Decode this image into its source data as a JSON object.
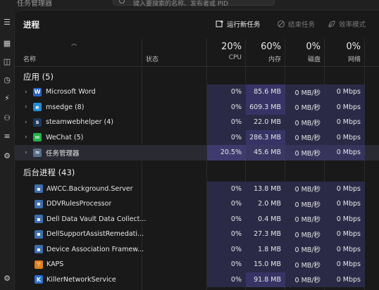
{
  "window": {
    "title": "任务管理器",
    "search_placeholder": "键入要搜索的名称、发布者或 PID"
  },
  "nav": {
    "items": [
      {
        "name": "hamburger-menu-icon",
        "glyph": "☰"
      },
      {
        "name": "processes-icon",
        "glyph": "▦"
      },
      {
        "name": "performance-icon",
        "glyph": "◫"
      },
      {
        "name": "app-history-icon",
        "glyph": "◷"
      },
      {
        "name": "startup-apps-icon",
        "glyph": "⚡"
      },
      {
        "name": "users-icon",
        "glyph": "⚇"
      },
      {
        "name": "details-icon",
        "glyph": "≡"
      },
      {
        "name": "services-icon",
        "glyph": "⚙"
      },
      {
        "name": "settings-icon",
        "glyph": "⚙"
      }
    ]
  },
  "toolbar": {
    "page_title": "进程",
    "run_new_task": "运行新任务",
    "end_task": "结束任务",
    "efficiency_mode": "效率模式"
  },
  "header": {
    "name_label": "名称",
    "status_label": "状态",
    "cpu_pct": "20%",
    "cpu_label": "CPU",
    "mem_pct": "60%",
    "mem_label": "内存",
    "disk_pct": "0%",
    "disk_label": "磁盘",
    "net_pct": "0%",
    "net_label": "网络"
  },
  "sections": {
    "apps_title": "应用 (5)",
    "background_title": "后台进程 (43)"
  },
  "apps": [
    {
      "name": "Microsoft Word",
      "icon": "word-icon",
      "icon_color": "#2b62c4",
      "glyph": "W",
      "cpu": "0%",
      "mem": "85.6 MB",
      "disk": "0 MB/秒",
      "net": "0 Mbps",
      "selected": false
    },
    {
      "name": "msedge (8)",
      "icon": "edge-icon",
      "icon_color": "#1f8fd6",
      "glyph": "e",
      "cpu": "0%",
      "mem": "609.3 MB",
      "disk": "0 MB/秒",
      "net": "0 Mbps",
      "selected": false
    },
    {
      "name": "steamwebhelper (4)",
      "icon": "steam-icon",
      "icon_color": "#1d3b5c",
      "glyph": "s",
      "cpu": "0%",
      "mem": "22.0 MB",
      "disk": "0 MB/秒",
      "net": "0 Mbps",
      "selected": false
    },
    {
      "name": "WeChat (5)",
      "icon": "wechat-icon",
      "icon_color": "#22b24c",
      "glyph": "✉",
      "cpu": "0%",
      "mem": "286.3 MB",
      "disk": "0 MB/秒",
      "net": "0 Mbps",
      "selected": false
    },
    {
      "name": "任务管理器",
      "icon": "task-manager-icon",
      "icon_color": "#5b6e8a",
      "glyph": "≈",
      "cpu": "20.5%",
      "mem": "45.6 MB",
      "disk": "0 MB/秒",
      "net": "0 Mbps",
      "selected": true
    }
  ],
  "background": [
    {
      "name": "AWCC.Background.Server",
      "icon": "app-window-icon",
      "icon_color": "#3d6fb0",
      "glyph": "▪",
      "cpu": "0%",
      "mem": "13.8 MB",
      "disk": "0 MB/秒",
      "net": "0 Mbps"
    },
    {
      "name": "DDVRulesProcessor",
      "icon": "app-window-icon",
      "icon_color": "#3d6fb0",
      "glyph": "▪",
      "cpu": "0%",
      "mem": "2.0 MB",
      "disk": "0 MB/秒",
      "net": "0 Mbps"
    },
    {
      "name": "Dell Data Vault Data Collect...",
      "icon": "app-window-icon",
      "icon_color": "#3d6fb0",
      "glyph": "▪",
      "cpu": "0%",
      "mem": "0.4 MB",
      "disk": "0 MB/秒",
      "net": "0 Mbps"
    },
    {
      "name": "DellSupportAssistRemedati...",
      "icon": "app-window-icon",
      "icon_color": "#3d6fb0",
      "glyph": "▪",
      "cpu": "0%",
      "mem": "27.3 MB",
      "disk": "0 MB/秒",
      "net": "0 Mbps"
    },
    {
      "name": "Device Association Framew...",
      "icon": "app-window-icon",
      "icon_color": "#3d6fb0",
      "glyph": "▪",
      "cpu": "0%",
      "mem": "1.8 MB",
      "disk": "0 MB/秒",
      "net": "0 Mbps"
    },
    {
      "name": "KAPS",
      "icon": "wifi-icon",
      "icon_color": "#e0801a",
      "glyph": "⌔",
      "cpu": "0%",
      "mem": "15.0 MB",
      "disk": "0 MB/秒",
      "net": "0 Mbps"
    },
    {
      "name": "KillerNetworkService",
      "icon": "killer-icon",
      "icon_color": "#2f6fd0",
      "glyph": "K",
      "cpu": "0%",
      "mem": "91.8 MB",
      "disk": "0 MB/秒",
      "net": "0 Mbps"
    }
  ],
  "colors": {
    "background": "#191919",
    "heat_low": "#2b2a46",
    "heat_high": "#373465",
    "selected_row": "#2a2a33"
  }
}
